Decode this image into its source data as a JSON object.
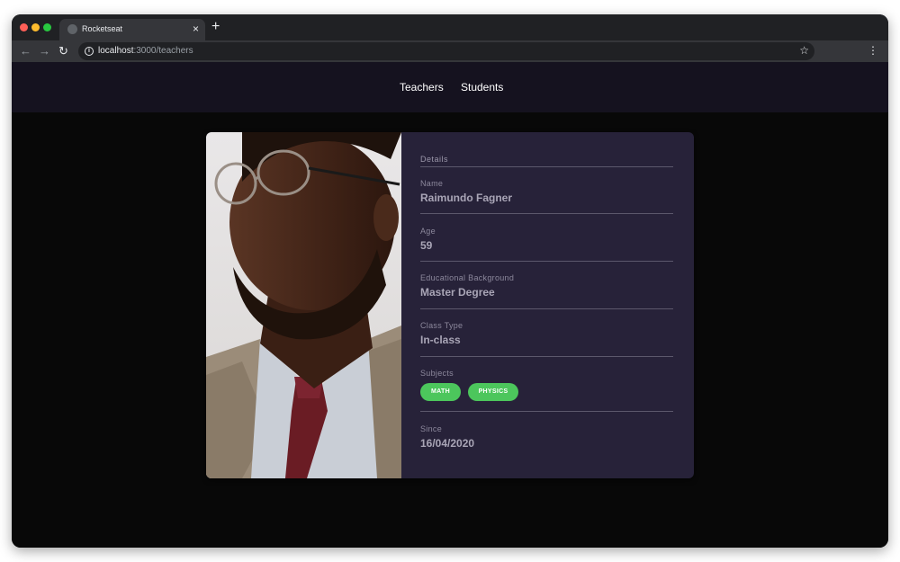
{
  "browser": {
    "tab_title": "Rocketseat",
    "tab_close": "×",
    "new_tab": "+",
    "url_host": "localhost",
    "url_path": ":3000/teachers",
    "back": "←",
    "forward": "→",
    "reload": "↻",
    "info": "i",
    "star": "☆",
    "menu": "⋮"
  },
  "nav": {
    "teachers": "Teachers",
    "students": "Students"
  },
  "card": {
    "section_title": "Details",
    "fields": [
      {
        "label": "Name",
        "value": "Raimundo Fagner"
      },
      {
        "label": "Age",
        "value": "59"
      },
      {
        "label": "Educational Background",
        "value": "Master Degree"
      },
      {
        "label": "Class Type",
        "value": "In-class"
      }
    ],
    "subjects_label": "Subjects",
    "subjects": [
      "MATH",
      "PHYSICS"
    ],
    "since_label": "Since",
    "since_value": "16/04/2020"
  },
  "colors": {
    "page_bg": "#080808",
    "header_bg": "#15121f",
    "card_bg": "#272239",
    "badge": "#4cc65c"
  }
}
